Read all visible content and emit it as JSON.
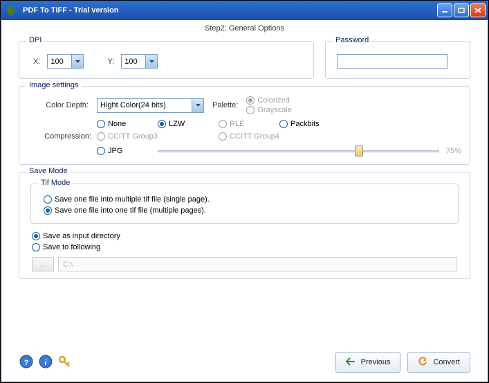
{
  "window": {
    "title": "PDF To TIFF - Trial version"
  },
  "step_header": "Step2: General Options",
  "dpi": {
    "legend": "DPI",
    "x_label": "X:",
    "y_label": "Y:",
    "x_value": "100",
    "y_value": "100"
  },
  "password": {
    "legend": "Password",
    "value": ""
  },
  "image_settings": {
    "legend": "Image settings",
    "color_depth_label": "Color Depth:",
    "color_depth_value": "Hight Color(24 bits)",
    "palette_label": "Palette:",
    "palette_colorized": "Colorized",
    "palette_grayscale": "Grayscale",
    "compression_label": "Compression:",
    "comp_none": "None",
    "comp_lzw": "LZW",
    "comp_rle": "RLE",
    "comp_packbits": "Packbits",
    "comp_ccitt3": "CCITT Group3",
    "comp_ccitt4": "CCITT Group4",
    "comp_jpg": "JPG",
    "jpg_quality": "75%"
  },
  "save_mode": {
    "legend": "Save Mode",
    "tif_mode_legend": "Tif Mode",
    "tif_single": "Save one file into multiple tif file (single page).",
    "tif_multi": "Save one file into one tif file (multiple pages).",
    "save_input_dir": "Save as input directory",
    "save_following": "Save to following",
    "browse_label": "...",
    "path_value": "C:\\"
  },
  "footer": {
    "previous": "Previous",
    "convert": "Convert"
  }
}
